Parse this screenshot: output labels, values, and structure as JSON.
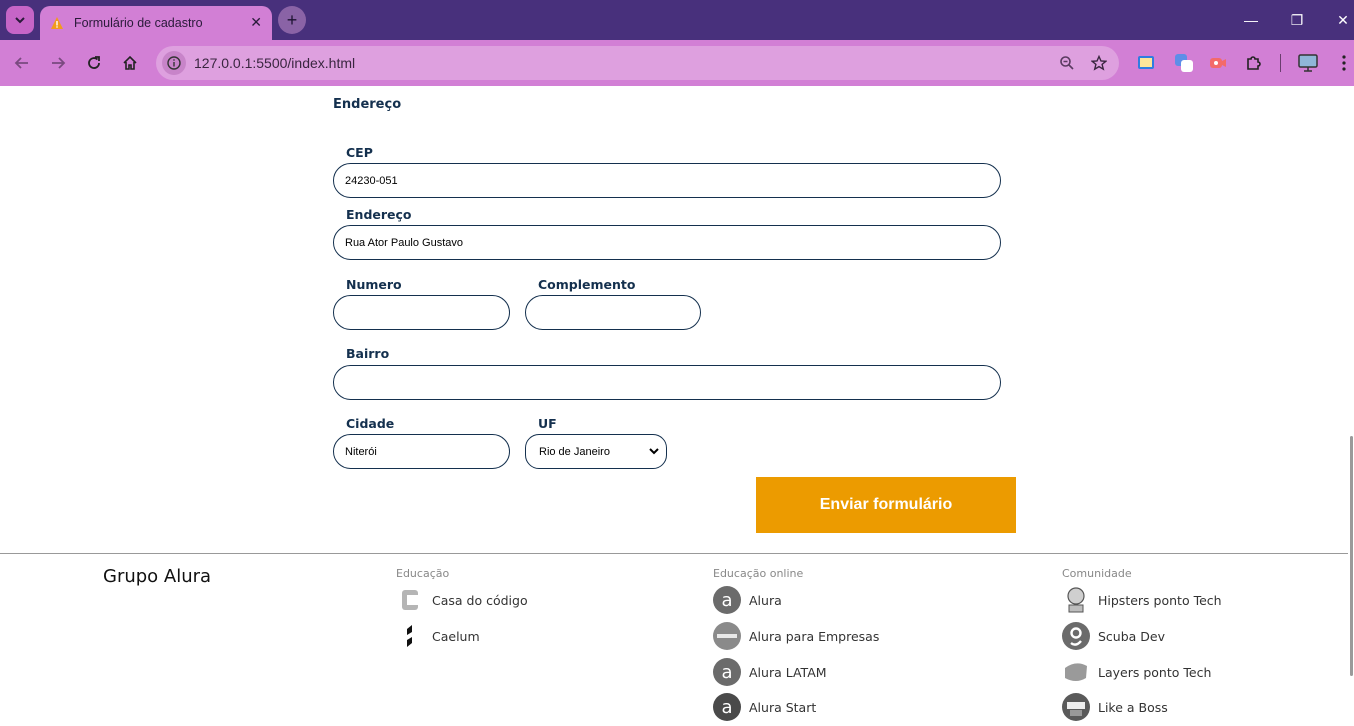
{
  "browser": {
    "tab_title": "Formulário de cadastro",
    "url": "127.0.0.1:5500/index.html"
  },
  "form": {
    "section_title": "Endereço",
    "cep_label": "CEP",
    "cep_value": "24230-051",
    "endereco_label": "Endereço",
    "endereco_value": "Rua Ator Paulo Gustavo",
    "numero_label": "Numero",
    "numero_value": "",
    "complemento_label": "Complemento",
    "complemento_value": "",
    "bairro_label": "Bairro",
    "bairro_value": "",
    "cidade_label": "Cidade",
    "cidade_value": "Niterói",
    "uf_label": "UF",
    "uf_value": "Rio de Janeiro",
    "submit_label": "Enviar formulário"
  },
  "footer": {
    "brand": "Grupo Alura",
    "columns": [
      {
        "title": "Educação",
        "links": [
          "Casa do código",
          "Caelum"
        ]
      },
      {
        "title": "Educação online",
        "links": [
          "Alura",
          "Alura para Empresas",
          "Alura LATAM",
          "Alura Start"
        ]
      },
      {
        "title": "Comunidade",
        "links": [
          "Hipsters ponto Tech",
          "Scuba Dev",
          "Layers ponto Tech",
          "Like a Boss"
        ]
      }
    ]
  },
  "colors": {
    "tabbar": "#48307c",
    "toolbar": "#d27fd5",
    "label": "#14304e",
    "submit": "#ec9b00"
  }
}
